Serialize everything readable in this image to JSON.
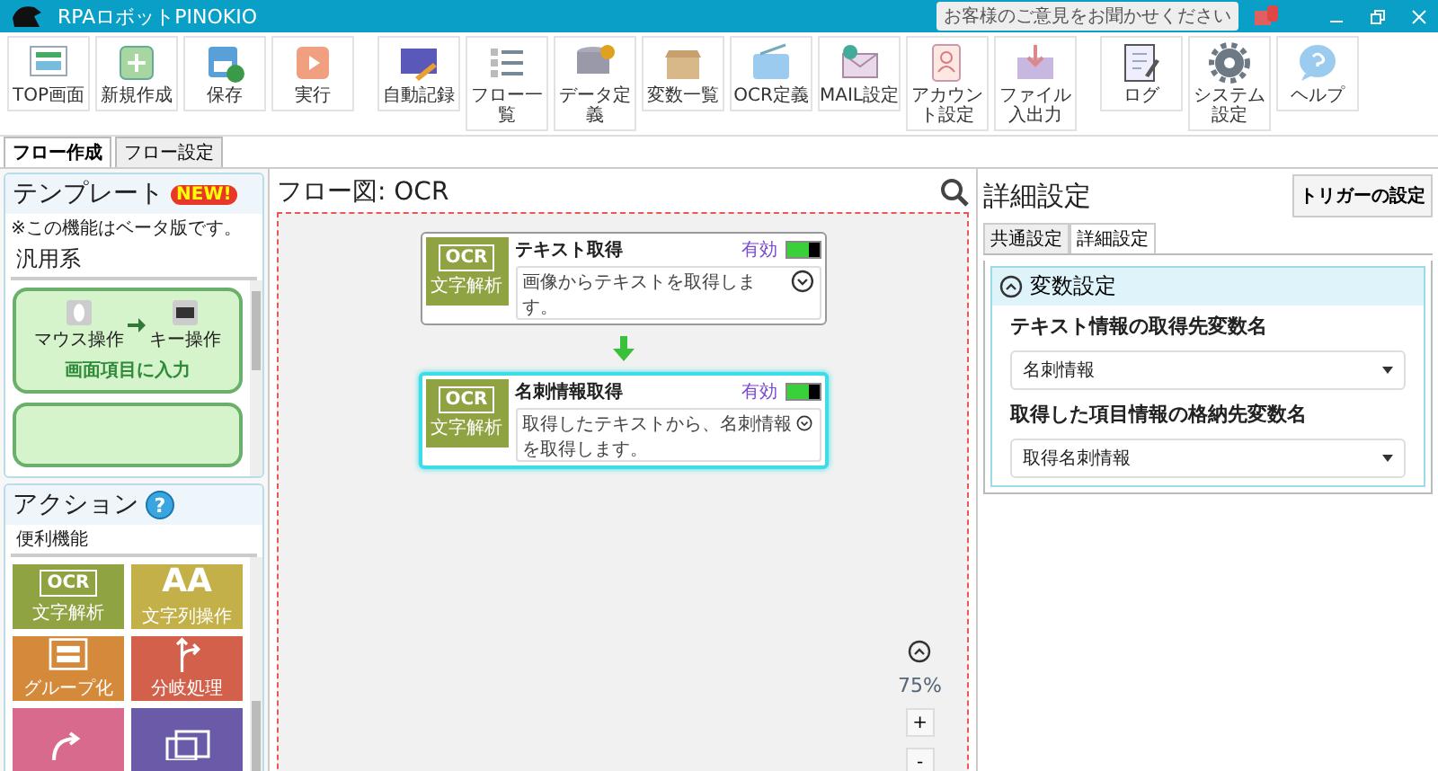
{
  "window": {
    "title": "RPAロボットPINOKIO",
    "feedback": "お客様のご意見をお聞かせください"
  },
  "toolbar": [
    {
      "label": "TOP画面",
      "kind": "top"
    },
    {
      "label": "新規作成",
      "kind": "new"
    },
    {
      "label": "保存",
      "kind": "save"
    },
    {
      "label": "実行",
      "kind": "run"
    },
    {
      "label": "自動記録",
      "kind": "record"
    },
    {
      "label": "フロー一覧",
      "kind": "list"
    },
    {
      "label": "データ定義",
      "kind": "data"
    },
    {
      "label": "変数一覧",
      "kind": "box"
    },
    {
      "label": "OCR定義",
      "kind": "ocr"
    },
    {
      "label": "MAIL設定",
      "kind": "mail"
    },
    {
      "label": "アカウント設定",
      "kind": "account"
    },
    {
      "label": "ファイル入出力",
      "kind": "file"
    },
    {
      "label": "ログ",
      "kind": "log"
    },
    {
      "label": "システム設定",
      "kind": "gear"
    },
    {
      "label": "ヘルプ",
      "kind": "help"
    }
  ],
  "tabs": [
    {
      "label": "フロー作成",
      "selected": true
    },
    {
      "label": "フロー設定",
      "selected": false
    }
  ],
  "templates": {
    "title": "テンプレート",
    "badge": "NEW!",
    "note": "※この機能はベータ版です。",
    "category": "汎用系",
    "cards": [
      {
        "label": "画面項目に入力",
        "from": "マウス操作",
        "to": "キー操作"
      }
    ]
  },
  "actions": {
    "title": "アクション",
    "help": "?",
    "category": "便利機能",
    "tiles": [
      {
        "kind": "ocr",
        "icon_text": "OCR",
        "label": "文字解析",
        "color": "#8fa342"
      },
      {
        "kind": "text",
        "icon_text": "AA",
        "label": "文字列操作",
        "color": "#c4b048"
      },
      {
        "kind": "group",
        "label": "グループ化",
        "color": "#d48a3a"
      },
      {
        "kind": "branch",
        "label": "分岐処理",
        "color": "#d2604a"
      },
      {
        "kind": "loop",
        "color": "#d86a8e"
      },
      {
        "kind": "window",
        "color": "#6a5aa8"
      }
    ]
  },
  "flow": {
    "title": "フロー図: OCR",
    "nodes": [
      {
        "title": "テキスト取得",
        "status": "有効",
        "on": true,
        "description": "画像からテキストを取得します。",
        "icon_text": "OCR",
        "icon_label": "文字解析",
        "selected": false
      },
      {
        "title": "名刺情報取得",
        "status": "有効",
        "on": true,
        "description": "取得したテキストから、名刺情報を取得します。",
        "icon_text": "OCR",
        "icon_label": "文字解析",
        "selected": true
      }
    ],
    "zoom": "75%",
    "zoom_in": "+",
    "zoom_out": "-"
  },
  "details": {
    "title": "詳細設定",
    "trigger_button": "トリガーの設定",
    "tabs": [
      {
        "label": "共通設定",
        "selected": false
      },
      {
        "label": "詳細設定",
        "selected": true
      }
    ],
    "section": {
      "title": "変数設定",
      "expanded": true,
      "fields": [
        {
          "label": "テキスト情報の取得先変数名",
          "value": "名刺情報"
        },
        {
          "label": "取得した項目情報の格納先変数名",
          "value": "取得名刺情報"
        }
      ]
    }
  }
}
